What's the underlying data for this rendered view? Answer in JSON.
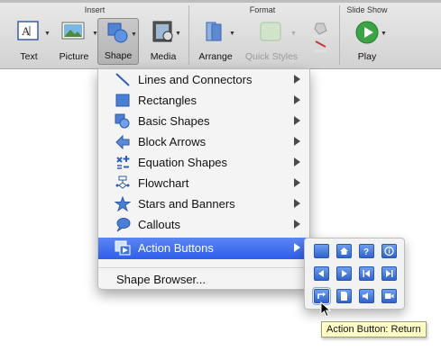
{
  "ribbon": {
    "groups": {
      "insert": "Insert",
      "format": "Format",
      "slideshow": "Slide Show"
    },
    "buttons": {
      "text": "Text",
      "picture": "Picture",
      "shape": "Shape",
      "media": "Media",
      "arrange": "Arrange",
      "quick_styles": "Quick Styles",
      "play": "Play"
    }
  },
  "menu": {
    "items": [
      {
        "label": "Lines and Connectors",
        "icon": "line-icon"
      },
      {
        "label": "Rectangles",
        "icon": "rectangle-icon"
      },
      {
        "label": "Basic Shapes",
        "icon": "basic-shapes-icon"
      },
      {
        "label": "Block Arrows",
        "icon": "block-arrow-icon"
      },
      {
        "label": "Equation Shapes",
        "icon": "equation-icon"
      },
      {
        "label": "Flowchart",
        "icon": "flowchart-icon"
      },
      {
        "label": "Stars and Banners",
        "icon": "star-icon"
      },
      {
        "label": "Callouts",
        "icon": "callout-icon"
      },
      {
        "label": "Action Buttons",
        "icon": "action-button-icon",
        "highlighted": true
      }
    ],
    "footer_item": "Shape Browser..."
  },
  "submenu": {
    "buttons": [
      {
        "icon": "blank-icon"
      },
      {
        "icon": "home-icon"
      },
      {
        "icon": "help-icon"
      },
      {
        "icon": "information-icon"
      },
      {
        "icon": "back-icon"
      },
      {
        "icon": "forward-icon"
      },
      {
        "icon": "beginning-icon"
      },
      {
        "icon": "end-icon"
      },
      {
        "icon": "return-icon",
        "active": true
      },
      {
        "icon": "document-icon"
      },
      {
        "icon": "sound-icon"
      },
      {
        "icon": "movie-icon"
      }
    ]
  },
  "tooltip": "Action Button: Return",
  "colors": {
    "highlight": "#2f5ee9",
    "action_button": "#3f74d8",
    "tooltip_bg": "#ffffc6"
  }
}
